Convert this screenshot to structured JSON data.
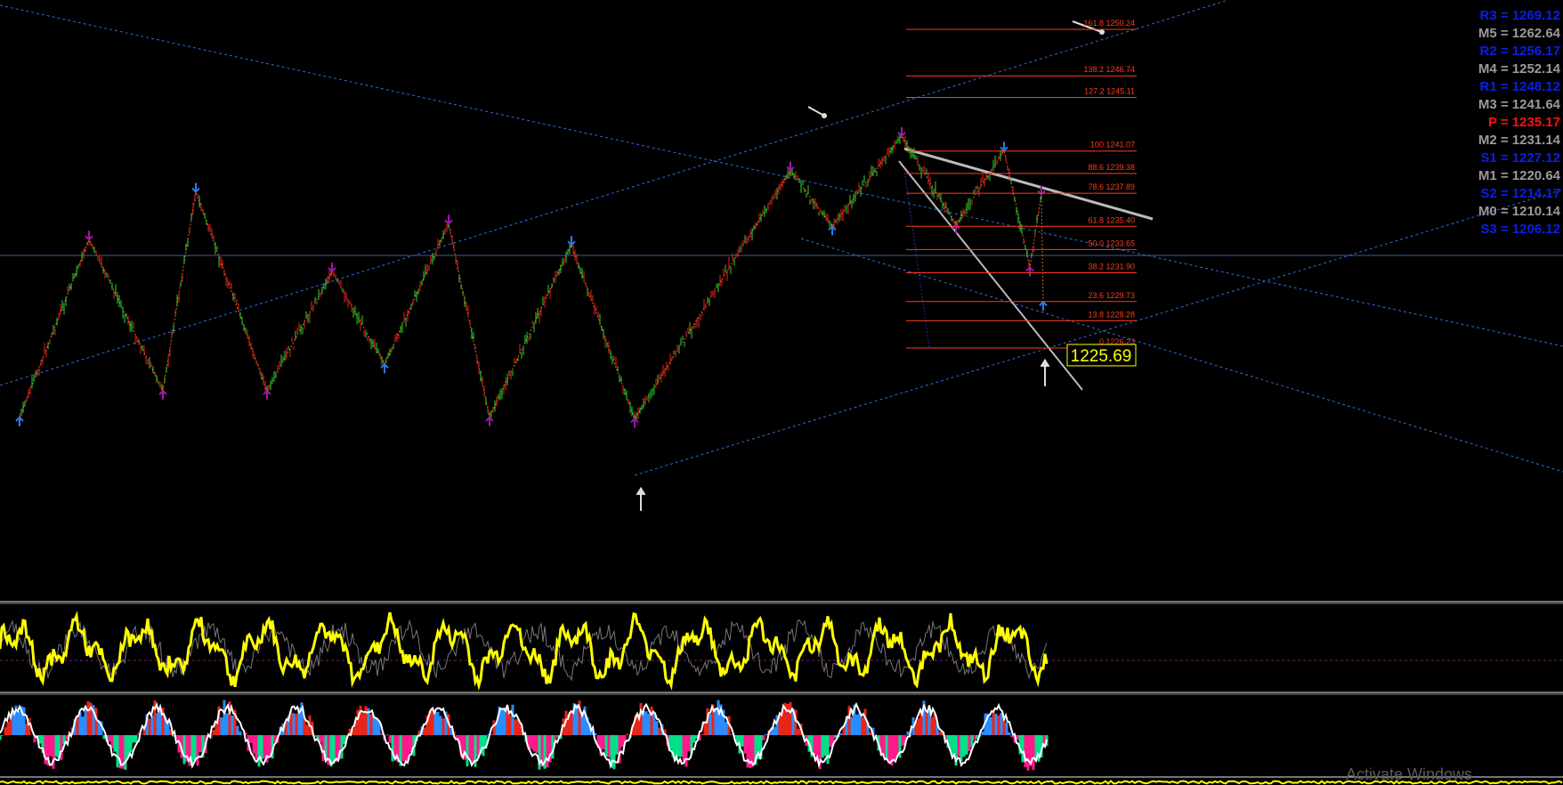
{
  "chart_data": {
    "type": "line",
    "instrument_price_current": "1225.69",
    "fibonacci_levels": [
      {
        "ratio": "161.8",
        "price": "1250.24"
      },
      {
        "ratio": "138.2",
        "price": "1246.74"
      },
      {
        "ratio": "127.2",
        "price": "1245.11"
      },
      {
        "ratio": "100",
        "price": "1241.07"
      },
      {
        "ratio": "88.6",
        "price": "1239.38"
      },
      {
        "ratio": "78.6",
        "price": "1237.89"
      },
      {
        "ratio": "61.8",
        "price": "1235.40"
      },
      {
        "ratio": "50.0",
        "price": "1233.65"
      },
      {
        "ratio": "38.2",
        "price": "1231.90"
      },
      {
        "ratio": "23.6",
        "price": "1229.73"
      },
      {
        "ratio": "13.8",
        "price": "1228.28"
      },
      {
        "ratio": "0",
        "price": "1226.23"
      }
    ],
    "pivot_levels": [
      {
        "label": "R3",
        "value": "1269.12",
        "color": "#0a1fe8"
      },
      {
        "label": "M5",
        "value": "1262.64",
        "color": "#9a9a9a"
      },
      {
        "label": "R2",
        "value": "1256.17",
        "color": "#0a1fe8"
      },
      {
        "label": "M4",
        "value": "1252.14",
        "color": "#9a9a9a"
      },
      {
        "label": "R1",
        "value": "1248.12",
        "color": "#0a1fe8"
      },
      {
        "label": "M3",
        "value": "1241.64",
        "color": "#9a9a9a"
      },
      {
        "label": "P",
        "value": "1235.17",
        "color": "#ff1010"
      },
      {
        "label": "M2",
        "value": "1231.14",
        "color": "#9a9a9a"
      },
      {
        "label": "S1",
        "value": "1227.12",
        "color": "#0a1fe8"
      },
      {
        "label": "M1",
        "value": "1220.64",
        "color": "#9a9a9a"
      },
      {
        "label": "S2",
        "value": "1214.17",
        "color": "#0a1fe8"
      },
      {
        "label": "M0",
        "value": "1210.14",
        "color": "#9a9a9a"
      },
      {
        "label": "S3",
        "value": "1206.12",
        "color": "#0a1fe8"
      }
    ],
    "swing_points": [
      {
        "kind": "low",
        "price": 1221.0
      },
      {
        "kind": "high",
        "price": 1234.4
      },
      {
        "kind": "low",
        "price": 1223.0
      },
      {
        "kind": "high",
        "price": 1238.0
      },
      {
        "kind": "low",
        "price": 1223.0
      },
      {
        "kind": "high",
        "price": 1232.0
      },
      {
        "kind": "low",
        "price": 1225.0
      },
      {
        "kind": "high",
        "price": 1235.6
      },
      {
        "kind": "low",
        "price": 1221.0
      },
      {
        "kind": "high",
        "price": 1234.0
      },
      {
        "kind": "low",
        "price": 1220.9
      },
      {
        "kind": "high",
        "price": 1239.6
      },
      {
        "kind": "low",
        "price": 1235.4
      },
      {
        "kind": "high",
        "price": 1242.2
      },
      {
        "kind": "low",
        "price": 1235.5
      },
      {
        "kind": "high",
        "price": 1241.1
      },
      {
        "kind": "low",
        "price": 1232.3
      },
      {
        "kind": "high",
        "price": 1237.8
      },
      {
        "kind": "low",
        "price": 1229.7
      }
    ],
    "colors": {
      "bull": "#2fd42f",
      "bear": "#e8251a",
      "fib": "#ff3b1f",
      "trend_line": "#2a6fe0",
      "osc_main": "#ffff00",
      "swing_high_arrow": "#9c1aa8",
      "swing_low_arrow": "#2a7cf0"
    },
    "grid": false
  },
  "watermark": "Activate Windows"
}
